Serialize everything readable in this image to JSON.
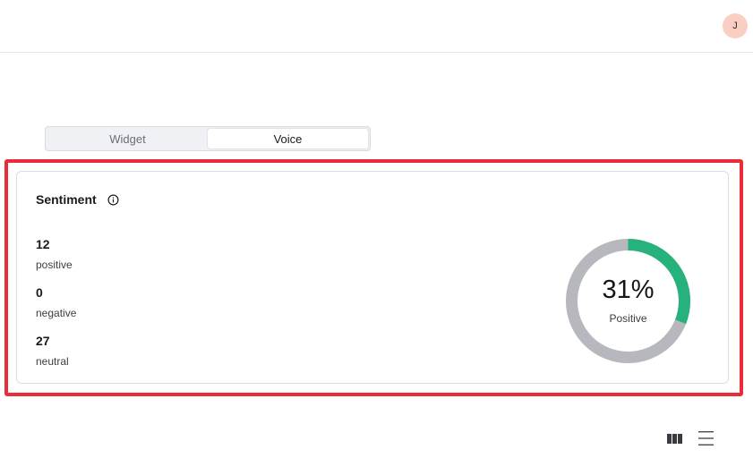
{
  "header": {
    "avatar_initial": "J"
  },
  "tabs": [
    {
      "label": "Widget",
      "active": false
    },
    {
      "label": "Voice",
      "active": true
    }
  ],
  "sentiment": {
    "title": "Sentiment",
    "stats": [
      {
        "value": "12",
        "label": "positive"
      },
      {
        "value": "0",
        "label": "negative"
      },
      {
        "value": "27",
        "label": "neutral"
      }
    ],
    "donut": {
      "percent_text": "31%",
      "label": "Positive",
      "positive_fraction": 0.31,
      "colors": {
        "positive": "#27b27d",
        "rest": "#b7b8be"
      }
    }
  },
  "icons": {
    "info": "info-circle-icon",
    "grid_view": "columns-view-icon",
    "list_view": "list-view-icon"
  },
  "colors": {
    "highlight_border": "#ec2a3a",
    "avatar_bg": "#f8cfc2"
  }
}
